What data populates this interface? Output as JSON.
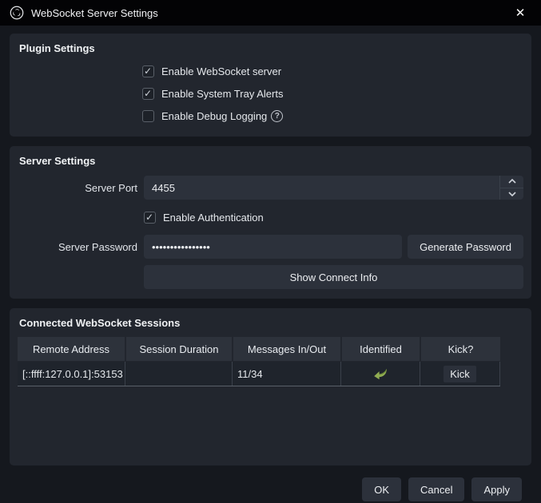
{
  "window": {
    "title": "WebSocket Server Settings",
    "close_glyph": "✕"
  },
  "plugin_settings": {
    "title": "Plugin Settings",
    "checkboxes": [
      {
        "label": "Enable WebSocket server",
        "checked": true
      },
      {
        "label": "Enable System Tray Alerts",
        "checked": true
      },
      {
        "label": "Enable Debug Logging",
        "checked": false
      }
    ],
    "help_glyph": "?"
  },
  "server_settings": {
    "title": "Server Settings",
    "port_label": "Server Port",
    "port_value": "4455",
    "auth_label": "Enable Authentication",
    "auth_checked": true,
    "password_label": "Server Password",
    "password_value": "••••••••••••••••",
    "generate_button": "Generate Password",
    "connect_info_button": "Show Connect Info"
  },
  "sessions": {
    "title": "Connected WebSocket Sessions",
    "columns": [
      "Remote Address",
      "Session Duration",
      "Messages In/Out",
      "Identified",
      "Kick?"
    ],
    "rows": [
      {
        "remote_address": "[::ffff:127.0.0.1]:53153",
        "session_duration": "",
        "messages_in_out": "11/34",
        "identified": true,
        "kick_label": "Kick"
      }
    ]
  },
  "footer": {
    "ok": "OK",
    "cancel": "Cancel",
    "apply": "Apply"
  },
  "colors": {
    "identified_green": "#91ad52",
    "identified_green_dark": "#6d8a39",
    "group_bg": "#22262e",
    "input_bg": "#2c313b"
  }
}
